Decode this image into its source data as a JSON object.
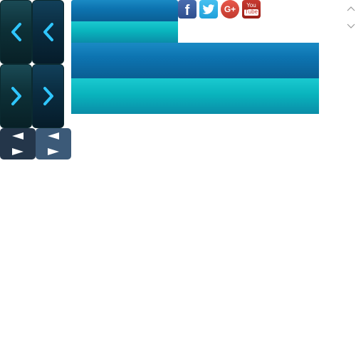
{
  "icons": {
    "tile_left_1": "chevron-left-icon",
    "tile_left_2": "chevron-left-icon",
    "tile_right_1": "chevron-right-icon",
    "tile_right_2": "chevron-right-icon",
    "mini_prev": "triangle-left-icon",
    "mini_next": "triangle-right-icon",
    "facebook": "facebook-icon",
    "twitter": "twitter-icon",
    "google_plus": "google-plus-icon",
    "youtube": "youtube-icon",
    "scroll_up": "chevron-up-icon",
    "scroll_down": "chevron-down-icon"
  },
  "social": {
    "facebook_glyph": "f",
    "google_plus_glyph": "G+",
    "youtube_top": "You",
    "youtube_bottom": "Tube"
  },
  "colors": {
    "chevron_glow": "#2fc6ff",
    "bar_blue": "#0d74b1",
    "bar_teal": "#09b4bd",
    "mini_dark": "#24364a",
    "mini_light": "#3c5a78"
  }
}
